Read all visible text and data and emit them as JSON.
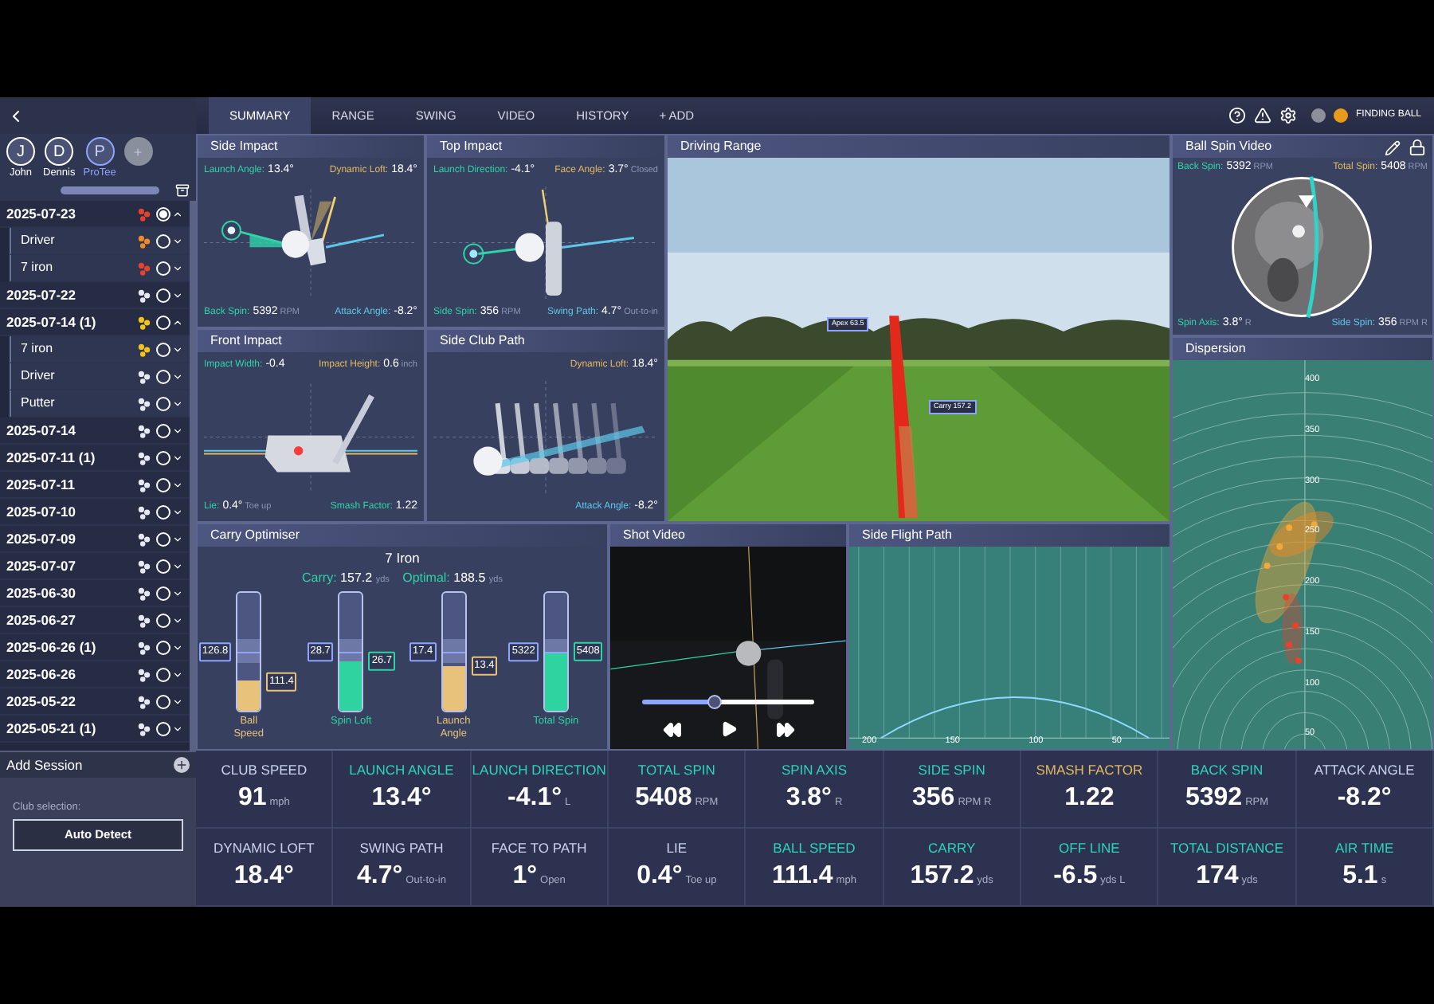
{
  "tabs": [
    {
      "label": "SUMMARY",
      "selected": true
    },
    {
      "label": "RANGE",
      "selected": false
    },
    {
      "label": "SWING",
      "selected": false
    },
    {
      "label": "VIDEO",
      "selected": false
    },
    {
      "label": "HISTORY",
      "selected": false
    }
  ],
  "add_tab": "+ ADD",
  "status": "FINDING BALL",
  "players": [
    {
      "initial": "J",
      "name": "John",
      "selected": false
    },
    {
      "initial": "D",
      "name": "Dennis",
      "selected": false
    },
    {
      "initial": "P",
      "name": "ProTee",
      "selected": true
    }
  ],
  "sessions": [
    {
      "date": "2025-07-23",
      "color": "#e8412c",
      "selected": true,
      "expanded": true,
      "children": [
        {
          "date": "Driver",
          "color": "#f08a24",
          "selected": false
        },
        {
          "date": "7 iron",
          "color": "#e8412c",
          "selected": false
        }
      ]
    },
    {
      "date": "2025-07-22",
      "color": "#e6e9f2",
      "selected": false,
      "expanded": false
    },
    {
      "date": "2025-07-14 (1)",
      "color": "#f2c418",
      "selected": false,
      "expanded": true,
      "children": [
        {
          "date": "7 iron",
          "color": "#f2c418",
          "selected": false
        },
        {
          "date": "Driver",
          "color": "#e6e9f2",
          "selected": false
        },
        {
          "date": "Putter",
          "color": "#e6e9f2",
          "selected": false
        }
      ]
    },
    {
      "date": "2025-07-14",
      "color": "#e6e9f2",
      "selected": false,
      "expanded": false
    },
    {
      "date": "2025-07-11 (1)",
      "color": "#e6e9f2",
      "selected": false,
      "expanded": false
    },
    {
      "date": "2025-07-11",
      "color": "#e6e9f2",
      "selected": false,
      "expanded": false
    },
    {
      "date": "2025-07-10",
      "color": "#e6e9f2",
      "selected": false,
      "expanded": false
    },
    {
      "date": "2025-07-09",
      "color": "#e6e9f2",
      "selected": false,
      "expanded": false
    },
    {
      "date": "2025-07-07",
      "color": "#e6e9f2",
      "selected": false,
      "expanded": false
    },
    {
      "date": "2025-06-30",
      "color": "#e6e9f2",
      "selected": false,
      "expanded": false
    },
    {
      "date": "2025-06-27",
      "color": "#e6e9f2",
      "selected": false,
      "expanded": false
    },
    {
      "date": "2025-06-26 (1)",
      "color": "#e6e9f2",
      "selected": false,
      "expanded": false
    },
    {
      "date": "2025-06-26",
      "color": "#e6e9f2",
      "selected": false,
      "expanded": false
    },
    {
      "date": "2025-05-22",
      "color": "#e6e9f2",
      "selected": false,
      "expanded": false
    },
    {
      "date": "2025-05-21 (1)",
      "color": "#e6e9f2",
      "selected": false,
      "expanded": false
    }
  ],
  "add_session": {
    "title": "Add Session",
    "club_label": "Club selection:",
    "club_button": "Auto Detect"
  },
  "impact_panels": [
    {
      "kind": "side",
      "title": "Side Impact",
      "stats": [
        {
          "label": "Launch Angle:",
          "value": "13.4°",
          "color": "#2fd3a8"
        },
        {
          "label": "Dynamic Loft:",
          "value": "18.4°",
          "color": "#e2b860"
        },
        {
          "label": "Back Spin:",
          "value": "5392",
          "unit": "RPM",
          "color": "#2fd3a8"
        },
        {
          "label": "Attack Angle:",
          "value": "-8.2°",
          "color": "#5ec8ea"
        }
      ]
    },
    {
      "kind": "top",
      "title": "Top Impact",
      "stats": [
        {
          "label": "Launch Direction:",
          "value": "-4.1°",
          "color": "#2fd3a8"
        },
        {
          "label": "Face Angle:",
          "value": "3.7°",
          "unit": "Closed",
          "color": "#e2b860"
        },
        {
          "label": "Side Spin:",
          "value": "356",
          "unit": "RPM",
          "color": "#2fd3a8"
        },
        {
          "label": "Swing Path:",
          "value": "4.7°",
          "unit": "Out-to-in",
          "color": "#5ec8ea"
        }
      ]
    },
    {
      "kind": "front",
      "title": "Front Impact",
      "stats": [
        {
          "label": "Impact Width:",
          "value": "-0.4",
          "color": "#2fd3a8"
        },
        {
          "label": "Impact Height:",
          "value": "0.6",
          "unit": "inch",
          "color": "#e2b860"
        },
        {
          "label": "Lie:",
          "value": "0.4°",
          "unit": "Toe up",
          "color": "#2fd3a8"
        },
        {
          "label": "Smash Factor:",
          "value": "1.22",
          "color": "#2fd3a8"
        }
      ]
    },
    {
      "kind": "path",
      "title": "Side Club Path",
      "stats": [
        {
          "label": "Dynamic Loft:",
          "value": "18.4°",
          "color": "#e2b860"
        },
        {
          "label": "Attack Angle:",
          "value": "-8.2°",
          "color": "#5ec8ea"
        }
      ]
    }
  ],
  "driving_range": {
    "title": "Driving Range",
    "tags": [
      "Apex 63.5",
      "Carry 157.2"
    ]
  },
  "ball_spin": {
    "title": "Ball Spin Video",
    "stats": [
      {
        "label": "Back Spin:",
        "value": "5392",
        "unit": "RPM",
        "color": "#2fd3a8"
      },
      {
        "label": "Total Spin:",
        "value": "5408",
        "unit": "RPM",
        "color": "#e2b860"
      },
      {
        "label": "Spin Axis:",
        "value": "3.8°",
        "unit": "R",
        "color": "#2fd3a8"
      },
      {
        "label": "Side Spin:",
        "value": "356",
        "unit": "RPM R",
        "color": "#5ec8ea"
      }
    ]
  },
  "dispersion": {
    "title": "Dispersion",
    "ring_labels": [
      "400",
      "350",
      "300",
      "250",
      "200",
      "150",
      "100",
      "50"
    ]
  },
  "carry_optimiser": {
    "title": "Carry Optimiser",
    "club": "7 Iron",
    "carry_label": "Carry:",
    "carry": "157.2",
    "carry_unit": "yds",
    "optimal_label": "Optimal:",
    "optimal": "188.5",
    "optimal_unit": "yds",
    "bars": [
      {
        "label": "Ball Speed",
        "color": "#e8c27a",
        "level": 0.25,
        "target": "126.8",
        "actual": "111.4"
      },
      {
        "label": "Spin Loft",
        "color": "#2fd3a0",
        "level": 0.42,
        "target": "28.7",
        "actual": "26.7"
      },
      {
        "label": "Launch Angle",
        "color": "#e8c27a",
        "level": 0.38,
        "target": "17.4",
        "actual": "13.4"
      },
      {
        "label": "Total Spin",
        "color": "#2fd3a0",
        "level": 0.5,
        "target": "5322",
        "actual": "5408"
      }
    ]
  },
  "shot_video": {
    "title": "Shot Video",
    "level": 0.42
  },
  "side_flight": {
    "title": "Side Flight Path",
    "axis_labels": [
      "200",
      "150",
      "100",
      "50"
    ]
  },
  "metrics": [
    {
      "label": "CLUB SPEED",
      "value": "91",
      "unit": "mph",
      "color": "#c9d2ee"
    },
    {
      "label": "LAUNCH ANGLE",
      "value": "13.4°",
      "color": "#2fd3b8"
    },
    {
      "label": "LAUNCH DIRECTION",
      "value": "-4.1°",
      "unit": "L",
      "color": "#2fd3b8"
    },
    {
      "label": "TOTAL SPIN",
      "value": "5408",
      "unit": "RPM",
      "color": "#2fd3b8"
    },
    {
      "label": "SPIN AXIS",
      "value": "3.8°",
      "unit": "R",
      "color": "#2fd3b8"
    },
    {
      "label": "SIDE SPIN",
      "value": "356",
      "unit": "RPM R",
      "color": "#2fd3b8"
    },
    {
      "label": "SMASH FACTOR",
      "value": "1.22",
      "color": "#e2b860"
    },
    {
      "label": "BACK SPIN",
      "value": "5392",
      "unit": "RPM",
      "color": "#2fd3b8"
    },
    {
      "label": "ATTACK ANGLE",
      "value": "-8.2°",
      "color": "#c9d2ee"
    },
    {
      "label": "DYNAMIC LOFT",
      "value": "18.4°",
      "color": "#c9d2ee"
    },
    {
      "label": "SWING PATH",
      "value": "4.7°",
      "unit": "Out-to-in",
      "color": "#c9d2ee"
    },
    {
      "label": "FACE TO PATH",
      "value": "1°",
      "unit": "Open",
      "color": "#c9d2ee"
    },
    {
      "label": "LIE",
      "value": "0.4°",
      "unit": "Toe up",
      "color": "#c9d2ee"
    },
    {
      "label": "BALL SPEED",
      "value": "111.4",
      "unit": "mph",
      "color": "#2fd3b8"
    },
    {
      "label": "CARRY",
      "value": "157.2",
      "unit": "yds",
      "color": "#2fd3b8"
    },
    {
      "label": "OFF LINE",
      "value": "-6.5",
      "unit": "yds L",
      "color": "#2fd3b8"
    },
    {
      "label": "TOTAL DISTANCE",
      "value": "174",
      "unit": "yds",
      "color": "#2fd3b8"
    },
    {
      "label": "AIR TIME",
      "value": "5.1",
      "unit": "s",
      "color": "#2fd3b8"
    }
  ]
}
